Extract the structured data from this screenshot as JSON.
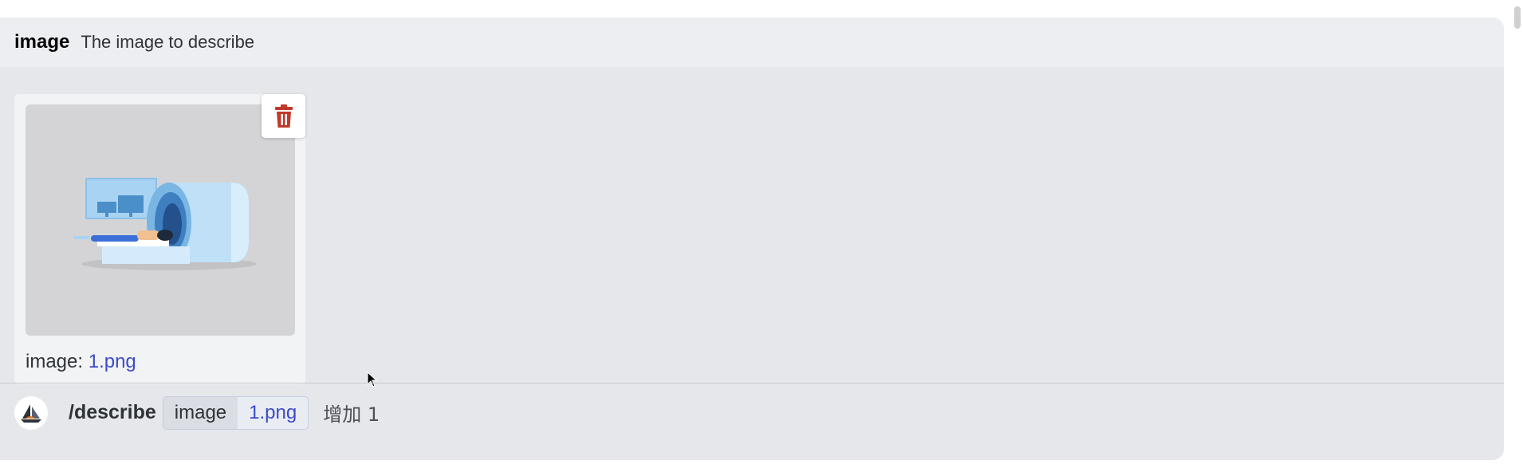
{
  "option": {
    "name": "image",
    "description": "The image to describe"
  },
  "attachment": {
    "caption_label": "image:",
    "filename": "1.png",
    "delete_icon": "trash-icon"
  },
  "command": {
    "name": "/describe",
    "option_key": "image",
    "option_value": "1.png",
    "extra": "增加 1"
  },
  "colors": {
    "delete_icon": "#c0392b",
    "link": "#3b4bc9"
  }
}
